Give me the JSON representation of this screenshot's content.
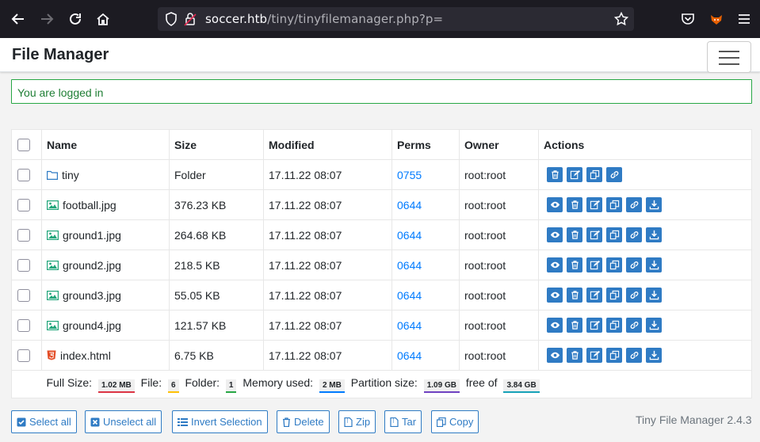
{
  "browser": {
    "url_host": "soccer.htb",
    "url_path": "/tiny/tinyfilemanager.php?p="
  },
  "header": {
    "brand": "File Manager"
  },
  "alert": {
    "text": "You are logged in"
  },
  "table": {
    "columns": [
      "Name",
      "Size",
      "Modified",
      "Perms",
      "Owner",
      "Actions"
    ],
    "rows": [
      {
        "name": "tiny",
        "icon": "folder-icon",
        "size": "Folder",
        "modified": "17.11.22 08:07",
        "perms": "0755",
        "owner": "root:root",
        "is_folder": true
      },
      {
        "name": "football.jpg",
        "icon": "image-icon",
        "size": "376.23 KB",
        "modified": "17.11.22 08:07",
        "perms": "0644",
        "owner": "root:root"
      },
      {
        "name": "ground1.jpg",
        "icon": "image-icon",
        "size": "264.68 KB",
        "modified": "17.11.22 08:07",
        "perms": "0644",
        "owner": "root:root"
      },
      {
        "name": "ground2.jpg",
        "icon": "image-icon",
        "size": "218.5 KB",
        "modified": "17.11.22 08:07",
        "perms": "0644",
        "owner": "root:root"
      },
      {
        "name": "ground3.jpg",
        "icon": "image-icon",
        "size": "55.05 KB",
        "modified": "17.11.22 08:07",
        "perms": "0644",
        "owner": "root:root"
      },
      {
        "name": "ground4.jpg",
        "icon": "image-icon",
        "size": "121.57 KB",
        "modified": "17.11.22 08:07",
        "perms": "0644",
        "owner": "root:root"
      },
      {
        "name": "index.html",
        "icon": "html5-icon",
        "size": "6.75 KB",
        "modified": "17.11.22 08:07",
        "perms": "0644",
        "owner": "root:root"
      }
    ]
  },
  "stats": {
    "full_size_label": "Full Size:",
    "full_size": "1.02 MB",
    "file_label": "File:",
    "file_count": "6",
    "folder_label": "Folder:",
    "folder_count": "1",
    "memory_label": "Memory used:",
    "memory": "2 MB",
    "partition_label": "Partition size:",
    "partition_free": "1.09 GB",
    "free_of_label": "free of",
    "partition_total": "3.84 GB"
  },
  "buttons": {
    "select_all": "Select all",
    "unselect_all": "Unselect all",
    "invert": "Invert Selection",
    "delete": "Delete",
    "zip": "Zip",
    "tar": "Tar",
    "copy": "Copy"
  },
  "footer": {
    "version": "Tiny File Manager 2.4.3"
  },
  "colors": {
    "accent": "#2f7bc4",
    "alert_green": "#28a745",
    "link": "#007bff",
    "browser_bg": "#1c1b22"
  }
}
